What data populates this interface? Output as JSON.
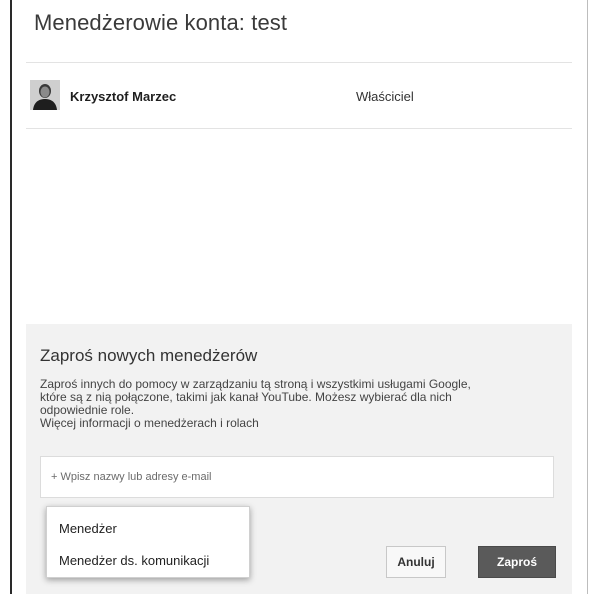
{
  "dialog": {
    "title": "Menedżerowie konta: test"
  },
  "managers": [
    {
      "name": "Krzysztof Marzec",
      "role": "Właściciel",
      "avatar_icon": "person-avatar"
    }
  ],
  "invite": {
    "title": "Zaproś nowych menedżerów",
    "description_line1": "Zaproś innych do pomocy w zarządzaniu tą stroną i wszystkimi usługami Google,",
    "description_line2": "które są z nią połączone, takimi jak kanał YouTube. Możesz wybierać dla nich",
    "description_line3": "odpowiednie role.",
    "more_link": "Więcej informacji o menedżerach i rolach",
    "email_placeholder": "+ Wpisz nazwy lub adresy e-mail"
  },
  "role_menu": {
    "options": [
      "Menedżer",
      "Menedżer ds. komunikacji"
    ]
  },
  "buttons": {
    "cancel": "Anuluj",
    "invite": "Zaproś"
  },
  "colors": {
    "invite_button_bg": "#5a5a5a",
    "panel_bg": "#f2f2f2"
  }
}
